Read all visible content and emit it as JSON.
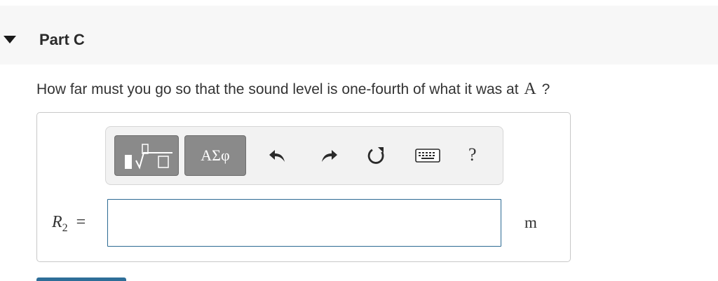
{
  "part": {
    "title": "Part C"
  },
  "question": {
    "text_before": "How far must you go so that the sound level is one-fourth of what it was at",
    "symbol": "A",
    "text_after": "?"
  },
  "toolbar": {
    "greek_label": "ΑΣφ",
    "help_label": "?",
    "icons": [
      "templates-icon",
      "undo-icon",
      "redo-icon",
      "reset-icon",
      "keyboard-icon"
    ]
  },
  "answer": {
    "variable": "R",
    "subscript": "2",
    "equals": "=",
    "value": "",
    "unit": "m"
  }
}
